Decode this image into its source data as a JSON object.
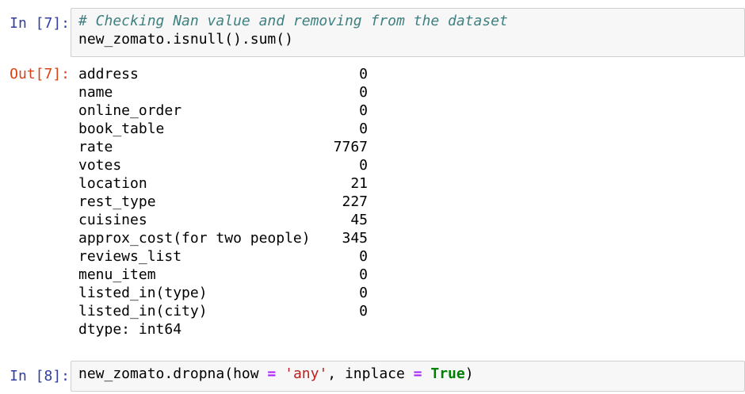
{
  "cell7": {
    "in_prompt": "In [7]:",
    "comment": "# Checking Nan value and removing from the dataset",
    "code": "new_zomato.isnull().sum()",
    "out_prompt": "Out[7]:",
    "output": [
      {
        "name": "address",
        "value": "0"
      },
      {
        "name": "name",
        "value": "0"
      },
      {
        "name": "online_order",
        "value": "0"
      },
      {
        "name": "book_table",
        "value": "0"
      },
      {
        "name": "rate",
        "value": "7767"
      },
      {
        "name": "votes",
        "value": "0"
      },
      {
        "name": "location",
        "value": "21"
      },
      {
        "name": "rest_type",
        "value": "227"
      },
      {
        "name": "cuisines",
        "value": "45"
      },
      {
        "name": "approx_cost(for two people)",
        "value": "345"
      },
      {
        "name": "reviews_list",
        "value": "0"
      },
      {
        "name": "menu_item",
        "value": "0"
      },
      {
        "name": "listed_in(type)",
        "value": "0"
      },
      {
        "name": "listed_in(city)",
        "value": "0"
      }
    ],
    "dtype": "dtype: int64"
  },
  "cell8": {
    "in_prompt": "In [8]:",
    "code_part1": "new_zomato.dropna(how ",
    "op1": "=",
    "code_part2": " ",
    "string_value": "'any'",
    "code_part3": ", inplace ",
    "op2": "=",
    "code_part4": " ",
    "keyword": "True",
    "code_part5": ")"
  }
}
